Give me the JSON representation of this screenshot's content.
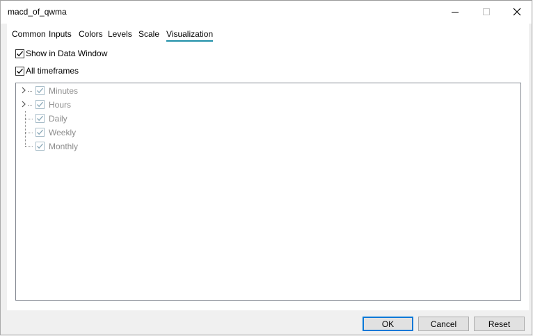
{
  "window": {
    "title": "macd_of_qwma"
  },
  "tabs": [
    {
      "label": "Common"
    },
    {
      "label": "Inputs"
    },
    {
      "label": "Colors"
    },
    {
      "label": "Levels"
    },
    {
      "label": "Scale"
    },
    {
      "label": "Visualization",
      "active": true
    }
  ],
  "options": {
    "show_in_data_window": {
      "label": "Show in Data Window",
      "checked": true
    },
    "all_timeframes": {
      "label": "All timeframes",
      "checked": true
    }
  },
  "tree": [
    {
      "label": "Minutes",
      "expandable": true,
      "checked": true,
      "enabled": false
    },
    {
      "label": "Hours",
      "expandable": true,
      "checked": true,
      "enabled": false
    },
    {
      "label": "Daily",
      "expandable": false,
      "checked": true,
      "enabled": false
    },
    {
      "label": "Weekly",
      "expandable": false,
      "checked": true,
      "enabled": false
    },
    {
      "label": "Monthly",
      "expandable": false,
      "checked": true,
      "enabled": false
    }
  ],
  "buttons": {
    "ok": "OK",
    "cancel": "Cancel",
    "reset": "Reset"
  },
  "colors": {
    "accent": "#0078d7",
    "tab_underline": "#1e8fa8",
    "disabled_text": "#8c8c8c"
  }
}
